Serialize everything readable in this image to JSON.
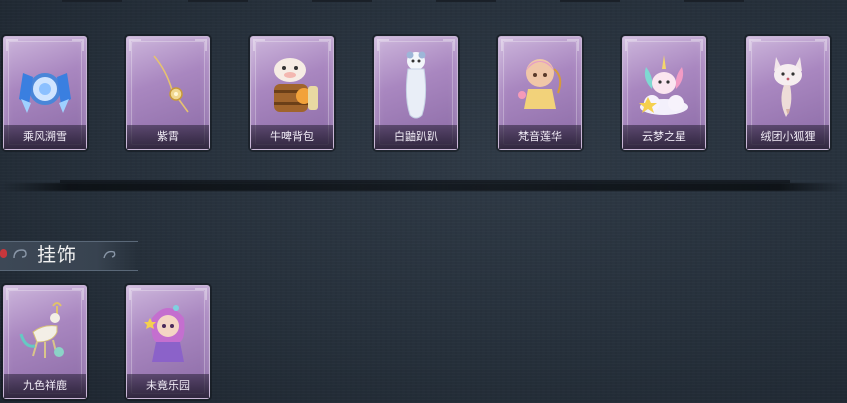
{
  "accessory_row": {
    "items": [
      {
        "name": "乘风溯雪",
        "icon": "blue-crystal-icon"
      },
      {
        "name": "紫霄",
        "icon": "golden-pendant-icon"
      },
      {
        "name": "牛啤背包",
        "icon": "cow-barrel-backpack-icon"
      },
      {
        "name": "白鼬趴趴",
        "icon": "white-ferret-icon"
      },
      {
        "name": "梵音莲华",
        "icon": "doll-lotus-icon"
      },
      {
        "name": "云梦之星",
        "icon": "unicorn-cloud-icon"
      },
      {
        "name": "绒团小狐狸",
        "icon": "fluffy-fox-icon"
      }
    ]
  },
  "pendant_section": {
    "title": "挂饰",
    "items": [
      {
        "name": "九色祥鹿",
        "icon": "nine-color-deer-icon"
      },
      {
        "name": "未竟乐园",
        "icon": "paradise-doll-icon"
      }
    ]
  },
  "colors": {
    "background": "#26303b",
    "card": "#a987c0",
    "header_dot": "#c8373c"
  }
}
